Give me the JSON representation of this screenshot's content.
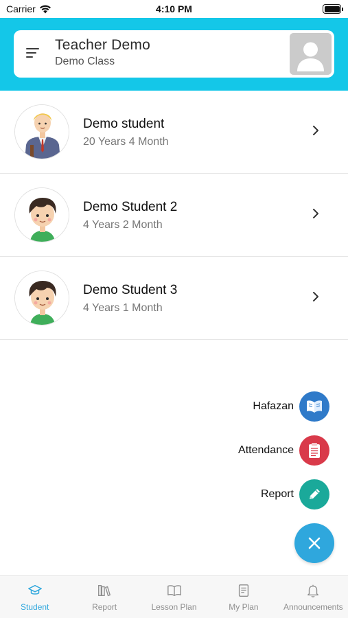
{
  "status_bar": {
    "carrier": "Carrier",
    "time": "4:10 PM"
  },
  "header": {
    "teacher_name": "Teacher Demo",
    "class_name": "Demo Class"
  },
  "students": [
    {
      "name": "Demo student",
      "age": "20 Years 4 Month",
      "avatar_icon": "schoolboy-with-backpack"
    },
    {
      "name": "Demo Student 2",
      "age": "4 Years 2 Month",
      "avatar_icon": "boy-face"
    },
    {
      "name": "Demo Student 3",
      "age": "4 Years 1 Month",
      "avatar_icon": "boy-face"
    }
  ],
  "fab_menu": {
    "items": [
      {
        "label": "Hafazan",
        "icon": "quran-book-icon",
        "color": "#2f7ac9"
      },
      {
        "label": "Attendance",
        "icon": "clipboard-icon",
        "color": "#d93a4a"
      },
      {
        "label": "Report",
        "icon": "pencil-icon",
        "color": "#1aa99a"
      }
    ],
    "close_icon": "close-icon",
    "close_color": "#2fa7dd"
  },
  "tab_bar": {
    "active_index": 0,
    "tabs": [
      {
        "label": "Student",
        "icon": "graduation-cap-icon"
      },
      {
        "label": "Report",
        "icon": "books-icon"
      },
      {
        "label": "Lesson Plan",
        "icon": "open-book-icon"
      },
      {
        "label": "My Plan",
        "icon": "notebook-icon"
      },
      {
        "label": "Announcements",
        "icon": "bell-icon"
      }
    ]
  },
  "colors": {
    "header_bg": "#14c7e8",
    "accent": "#2fa7dd"
  }
}
